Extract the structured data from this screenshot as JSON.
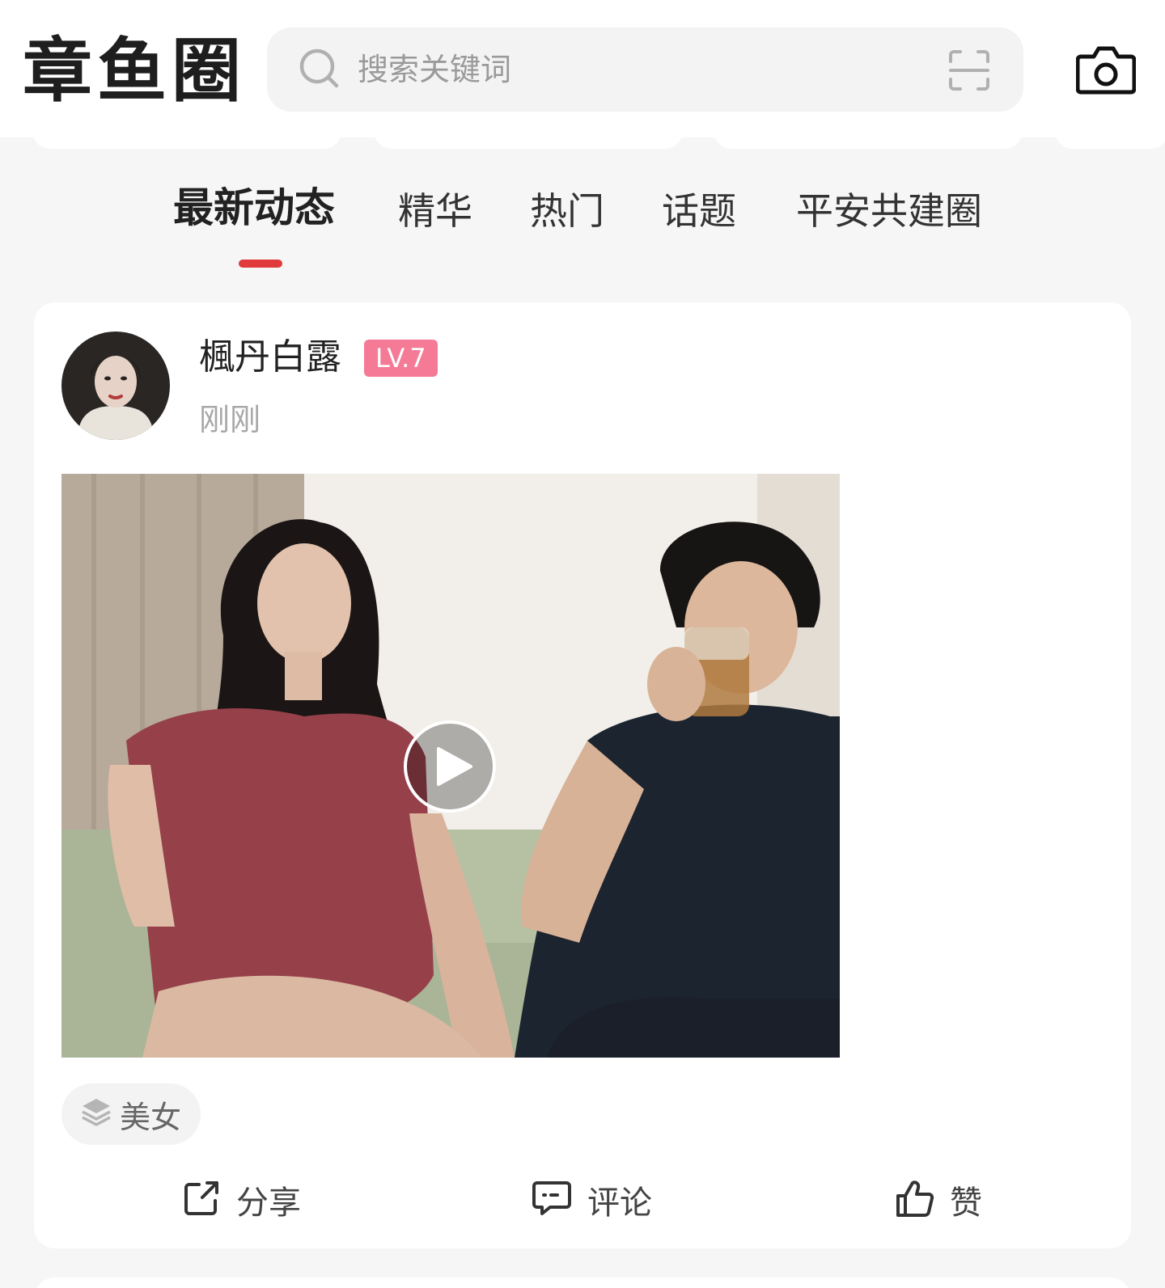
{
  "app": {
    "title": "章鱼圈"
  },
  "search": {
    "placeholder": "搜索关键词",
    "value": ""
  },
  "tabs": [
    {
      "label": "最新动态",
      "active": true
    },
    {
      "label": "精华",
      "active": false
    },
    {
      "label": "热门",
      "active": false
    },
    {
      "label": "话题",
      "active": false
    },
    {
      "label": "平安共建圈",
      "active": false
    }
  ],
  "post": {
    "author": "楓丹白露",
    "level": "LV.7",
    "time": "刚刚",
    "tag": "美女",
    "actions": {
      "share": "分享",
      "comment": "评论",
      "like": "赞"
    }
  },
  "icons": {
    "search": "search-icon",
    "scan": "scan-icon",
    "camera": "camera-icon",
    "play": "play-icon",
    "tag": "layers-icon",
    "share": "share-icon",
    "comment": "comment-icon",
    "like": "thumbs-up-icon"
  },
  "colors": {
    "accent": "#e03a3a",
    "level_badge": "#f47a96"
  }
}
